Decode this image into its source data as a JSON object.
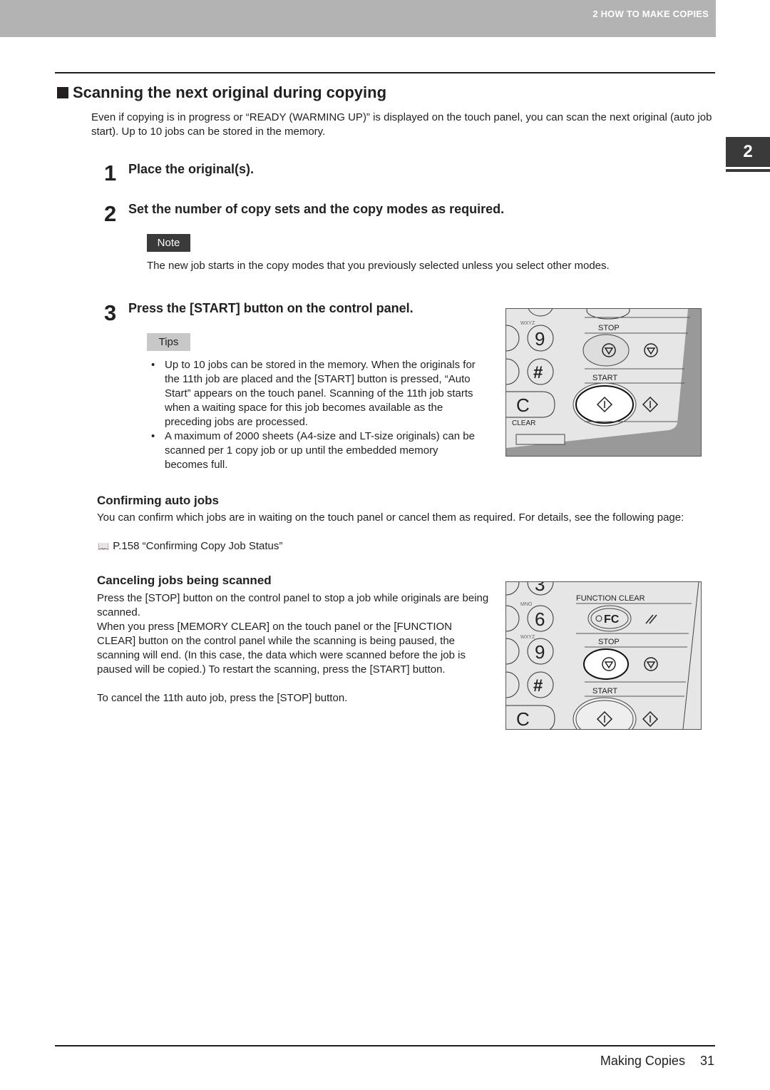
{
  "header": {
    "chapter": "2 HOW TO MAKE COPIES"
  },
  "side_tab": {
    "label": "2"
  },
  "section": {
    "title": "Scanning the next original during copying",
    "intro": "Even if copying is in progress or “READY (WARMING UP)” is displayed on the touch panel, you can scan the next original (auto job start). Up to 10 jobs can be stored in the memory."
  },
  "steps": [
    {
      "number": "1",
      "label": "Place the original(s)."
    },
    {
      "number": "2",
      "label": "Set the number of copy sets and the copy modes as required."
    },
    {
      "number": "3",
      "label": "Press the [START] button on the control panel."
    }
  ],
  "note": {
    "badge": "Note",
    "text": "The new job starts in the copy modes that you previously selected unless you select other modes."
  },
  "tips": {
    "badge": "Tips",
    "items": [
      "Up to 10 jobs can be stored in the memory. When the originals for the 11th job are placed and the [START] button is pressed, “Auto Start” appears on the touch panel. Scanning of the 11th job starts when a waiting space for this job becomes available as the preceding jobs are processed.",
      "A maximum of 2000 sheets (A4-size and LT-size originals) can be scanned per 1 copy job or up until the embedded memory becomes full."
    ]
  },
  "panel1": {
    "wxyz": "WXYZ",
    "key9": "9",
    "keyhash": "#",
    "keyC": "C",
    "stop": "STOP",
    "start": "START",
    "clear": "CLEAR"
  },
  "confirming": {
    "heading": "Confirming auto jobs",
    "text": "You can confirm which jobs are in waiting on the touch panel or cancel them as required. For details, see the following page:",
    "ref": "P.158 “Confirming Copy Job Status”",
    "ref_icon": "book-icon"
  },
  "canceling": {
    "heading": "Canceling jobs being scanned",
    "text1": "Press the [STOP] button on the control panel to stop a job while originals are being scanned.",
    "text2": "When you press [MEMORY CLEAR] on the touch panel or the [FUNCTION CLEAR] button on the control panel while the scanning is being paused, the scanning will end. (In this case, the data which were scanned before the job is paused will be copied.) To restart the scanning, press the [START] button.",
    "text3": "To cancel the 11th auto job, press the [STOP] button."
  },
  "panel2": {
    "mno": "MNO",
    "wxyz": "WXYZ",
    "key3": "3",
    "key6": "6",
    "key9": "9",
    "keyhash": "#",
    "keyC": "C",
    "function_clear": "FUNCTION CLEAR",
    "fc": "FC",
    "stop": "STOP",
    "start": "START"
  },
  "footer": {
    "section": "Making Copies",
    "page": "31"
  }
}
